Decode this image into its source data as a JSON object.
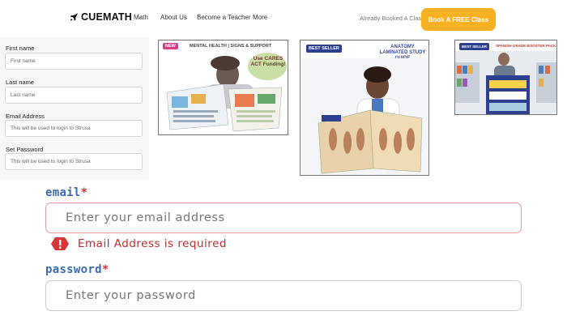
{
  "nav": {
    "logo": "CUEMATH",
    "links": [
      "Math",
      "About Us",
      "Become a Teacher",
      "More"
    ],
    "question": "Already Booked A Class?",
    "cta": "Book A FREE Class"
  },
  "signup_form": {
    "fields": [
      {
        "label": "First name",
        "placeholder": "First name"
      },
      {
        "label": "Last name",
        "placeholder": "Last name"
      },
      {
        "label": "Email Address",
        "placeholder": "This will be used to login to Strusa"
      },
      {
        "label": "Set Password",
        "placeholder": "This will be used to login to Strusa"
      }
    ]
  },
  "products": [
    {
      "badge": "NEW",
      "title": "MENTAL HEALTH | SIGNS & SUPPORT",
      "promo": "Use CARES ACT Funding!"
    },
    {
      "badge": "BEST SELLER",
      "title": "ANATOMY LAMINATED STUDY GUIDE"
    },
    {
      "badge": "BEST SELLER",
      "title": "SPANISH GRADE BOOSTER PACK"
    }
  ],
  "login": {
    "email_label": "email",
    "email_placeholder": "Enter your email address",
    "email_error": "Email Address is required",
    "password_label": "password",
    "password_placeholder": "Enter your password",
    "required_mark": "*"
  },
  "colors": {
    "cta": "#f9b021",
    "label_blue": "#3a6bb5",
    "error_red": "#c42e2e",
    "error_border": "#e79b9b"
  }
}
